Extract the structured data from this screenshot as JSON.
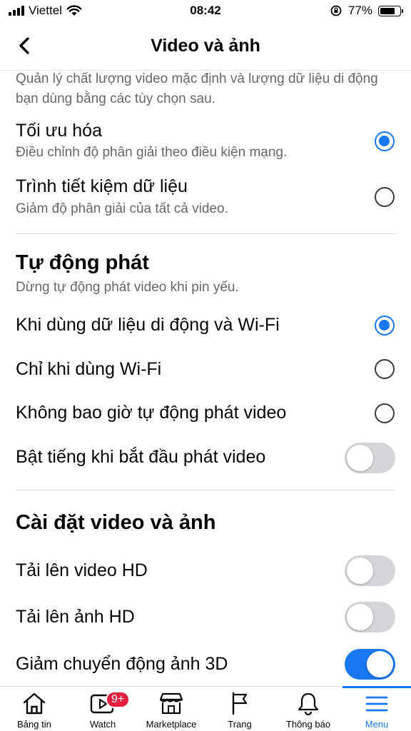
{
  "status_bar": {
    "carrier": "Viettel",
    "time": "08:42",
    "battery": "77%",
    "battery_level": 0.77
  },
  "header": {
    "title": "Video và ảnh"
  },
  "quality": {
    "intro": "Quản lý chất lượng video mặc định và lượng dữ liệu di động bạn dùng bằng các tùy chọn sau.",
    "options": [
      {
        "title": "Tối ưu hóa",
        "desc": "Điều chỉnh độ phân giải theo điều kiện mạng.",
        "selected": true
      },
      {
        "title": "Trình tiết kiệm dữ liệu",
        "desc": "Giảm độ phân giải của tất cả video.",
        "selected": false
      }
    ]
  },
  "autoplay": {
    "title": "Tự động phát",
    "desc": "Dừng tự động phát video khi pin yếu.",
    "options": [
      {
        "title": "Khi dùng dữ liệu di động và Wi-Fi",
        "selected": true
      },
      {
        "title": "Chỉ khi dùng Wi-Fi",
        "selected": false
      },
      {
        "title": "Không bao giờ tự động phát video",
        "selected": false
      }
    ],
    "sound_toggle": {
      "label": "Bật tiếng khi bắt đầu phát video",
      "on": false
    }
  },
  "media_settings": {
    "title": "Cài đặt video và ảnh",
    "toggles": [
      {
        "label": "Tải lên video HD",
        "on": false
      },
      {
        "label": "Tải lên ảnh HD",
        "on": false
      },
      {
        "label": "Giảm chuyển động ảnh 3D",
        "on": true
      }
    ]
  },
  "tabbar": {
    "tabs": [
      {
        "label": "Bảng tin",
        "icon": "home-icon"
      },
      {
        "label": "Watch",
        "icon": "watch-icon",
        "badge": "9+"
      },
      {
        "label": "Marketplace",
        "icon": "marketplace-icon"
      },
      {
        "label": "Trang",
        "icon": "flag-icon"
      },
      {
        "label": "Thông báo",
        "icon": "bell-icon"
      },
      {
        "label": "Menu",
        "icon": "menu-icon",
        "active": true
      }
    ]
  },
  "colors": {
    "accent": "#1877f2",
    "badge": "#e41e3f",
    "secondary_text": "#65676b",
    "toggle_off": "#d3d5d9"
  }
}
